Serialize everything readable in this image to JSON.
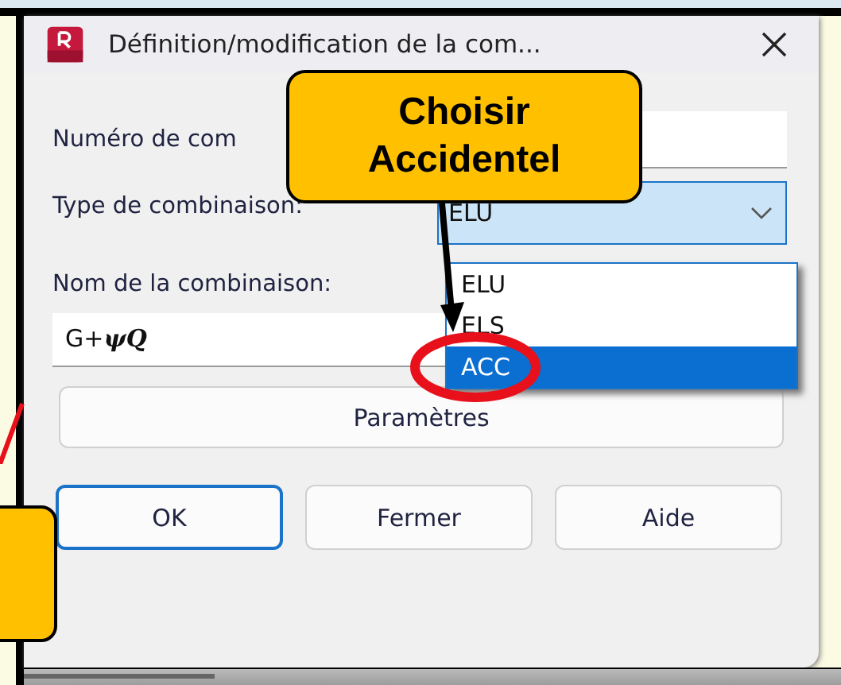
{
  "window": {
    "title": "Définition/modification de la com..."
  },
  "fields": [
    {
      "kind": "text",
      "label": "Numéro de com"
    },
    {
      "kind": "select",
      "label": "Type de combinaison:",
      "value": "ELU"
    },
    {
      "kind": "name",
      "label": "Nom de la combinaison:",
      "value": "G+**ψQ**"
    }
  ],
  "dropdown": {
    "options": [
      {
        "label": "ELU",
        "selected": false
      },
      {
        "label": "ELS",
        "selected": false
      },
      {
        "label": "ACC",
        "selected": true
      }
    ]
  },
  "parameters_button": "Paramètres",
  "buttons": [
    {
      "label": "OK",
      "default": true
    },
    {
      "label": "Fermer",
      "default": false
    },
    {
      "label": "Aide",
      "default": false
    }
  ],
  "callout": {
    "text": "Choisir Accidentel"
  }
}
